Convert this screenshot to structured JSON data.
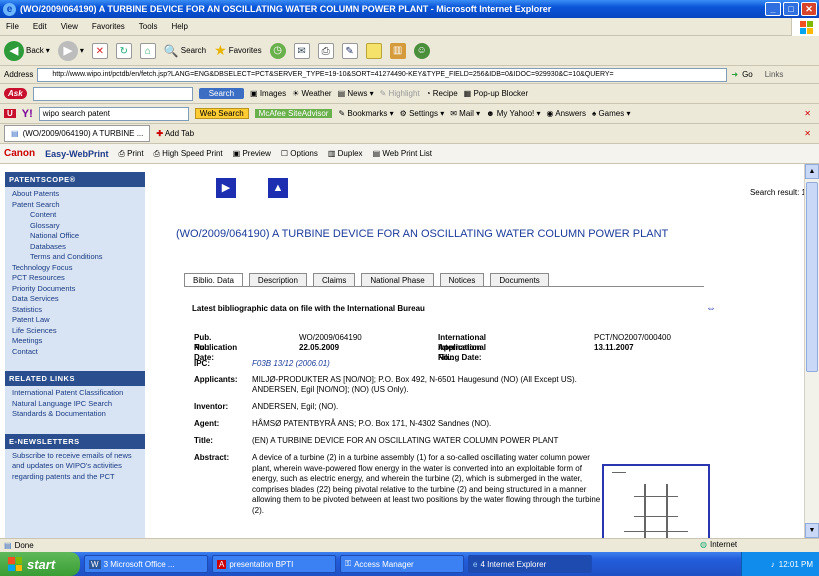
{
  "window": {
    "title": "(WO/2009/064190) A TURBINE DEVICE FOR AN OSCILLATING WATER COLUMN POWER PLANT - Microsoft Internet Explorer"
  },
  "menubar": [
    "File",
    "Edit",
    "View",
    "Favorites",
    "Tools",
    "Help"
  ],
  "toolbar": {
    "back_label": "Back",
    "search_label": "Search",
    "favorites_label": "Favorites"
  },
  "address": {
    "label": "Address",
    "url": "http://www.wipo.int/pctdb/en/fetch.jsp?LANG=ENG&DBSELECT=PCT&SERVER_TYPE=19-10&SORT=41274490-KEY&TYPE_FIELD=256&IDB=0&IDOC=929930&C=10&QUERY=",
    "go_label": "Go",
    "links_label": "Links"
  },
  "askbar": {
    "logo": "Ask",
    "search_button": "Search",
    "items": [
      "Images",
      "Weather",
      "News",
      "Highlight",
      "Recipe",
      "Pop-up Blocker"
    ]
  },
  "yahoobar": {
    "logo": "Y!",
    "search_value": "wipo search patent",
    "web_search": "Web Search",
    "items": [
      "McAfee SiteAdvisor",
      "Bookmarks",
      "Settings",
      "Mail",
      "My Yahoo!",
      "Answers",
      "Games"
    ]
  },
  "tabbar": {
    "tab_title": "(WO/2009/064190) A TURBINE ...",
    "add_tab": "Add Tab"
  },
  "canonbar": {
    "brand": "Canon",
    "product": "Easy-WebPrint",
    "items": [
      "Print",
      "High Speed Print",
      "Preview",
      "Options",
      "Duplex",
      "Web Print List"
    ]
  },
  "sidebar": {
    "section1_title": "PATENTSCOPE®",
    "section1_items": [
      "About Patents",
      "Patent Search"
    ],
    "section1_sub": [
      "Content",
      "Glossary",
      "National Office",
      "Databases",
      "Terms and Conditions"
    ],
    "section1_more": [
      "Technology Focus",
      "PCT Resources",
      "Priority Documents",
      "Data Services",
      "Statistics",
      "Patent Law",
      "Life Sciences",
      "Meetings",
      "Contact"
    ],
    "section2_title": "RELATED LINKS",
    "section2_items": [
      "International Patent Classification",
      "Natural Language IPC Search",
      "Standards & Documentation"
    ],
    "section3_title": "E-NEWSLETTERS",
    "section3_text": "Subscribe to receive emails of news and updates on WIPO's activities regarding patents and the PCT"
  },
  "page": {
    "search_result": "Search result: 1 of 78",
    "title": "(WO/2009/064190) A TURBINE DEVICE FOR AN OSCILLATING WATER COLUMN POWER PLANT",
    "tabs": [
      "Biblio. Data",
      "Description",
      "Claims",
      "National Phase",
      "Notices",
      "Documents"
    ],
    "latest": "Latest bibliographic data on file with the International Bureau",
    "pub_no_label": "Pub. No.:",
    "pub_no": "WO/2009/064190",
    "pub_date_label": "Publication Date:",
    "pub_date": "22.05.2009",
    "app_no_label": "International Application No.:",
    "app_no": "PCT/NO2007/000400",
    "filing_date_label": "International Filing Date:",
    "filing_date": "13.11.2007",
    "ipc_label": "IPC:",
    "ipc": "F03B 13/12 (2006.01)",
    "applicants_label": "Applicants:",
    "applicants_1": "MILJØ-PRODUKTER AS [NO/NO]; P.O. Box 492, N-6501 Haugesund (NO) (All Except US).",
    "applicants_2": "ANDERSEN, Egil [NO/NO]; (NO) (US Only).",
    "inventor_label": "Inventor:",
    "inventor": "ANDERSEN, Egil; (NO).",
    "agent_label": "Agent:",
    "agent": "HÅMSØ PATENTBYRÅ ANS; P.O. Box 171, N-4302 Sandnes (NO).",
    "title_label": "Title:",
    "title_value": "(EN) A TURBINE DEVICE FOR AN OSCILLATING WATER COLUMN POWER PLANT",
    "abstract_label": "Abstract:",
    "abstract": "A device of a turbine (2) in a turbine assembly (1) for a so-called oscillating water column power plant, wherein wave-powered flow energy in the water is converted into an exploitable form of energy, such as electric energy, and wherein the turbine (2), which is submerged in the water, comprises blades (22) being pivotal relative to the turbine (2) and being structured in a manner allowing them to be pivoted between at least two positions by the water flowing through the turbine (2)."
  },
  "statusbar": {
    "status": "Done",
    "zone": "Internet"
  },
  "taskbar": {
    "start": "start",
    "tasks": [
      "3 Microsoft Office ...",
      "presentation BPTI",
      "Access Manager",
      "4 Internet Explorer"
    ],
    "clock": "12:01 PM"
  }
}
